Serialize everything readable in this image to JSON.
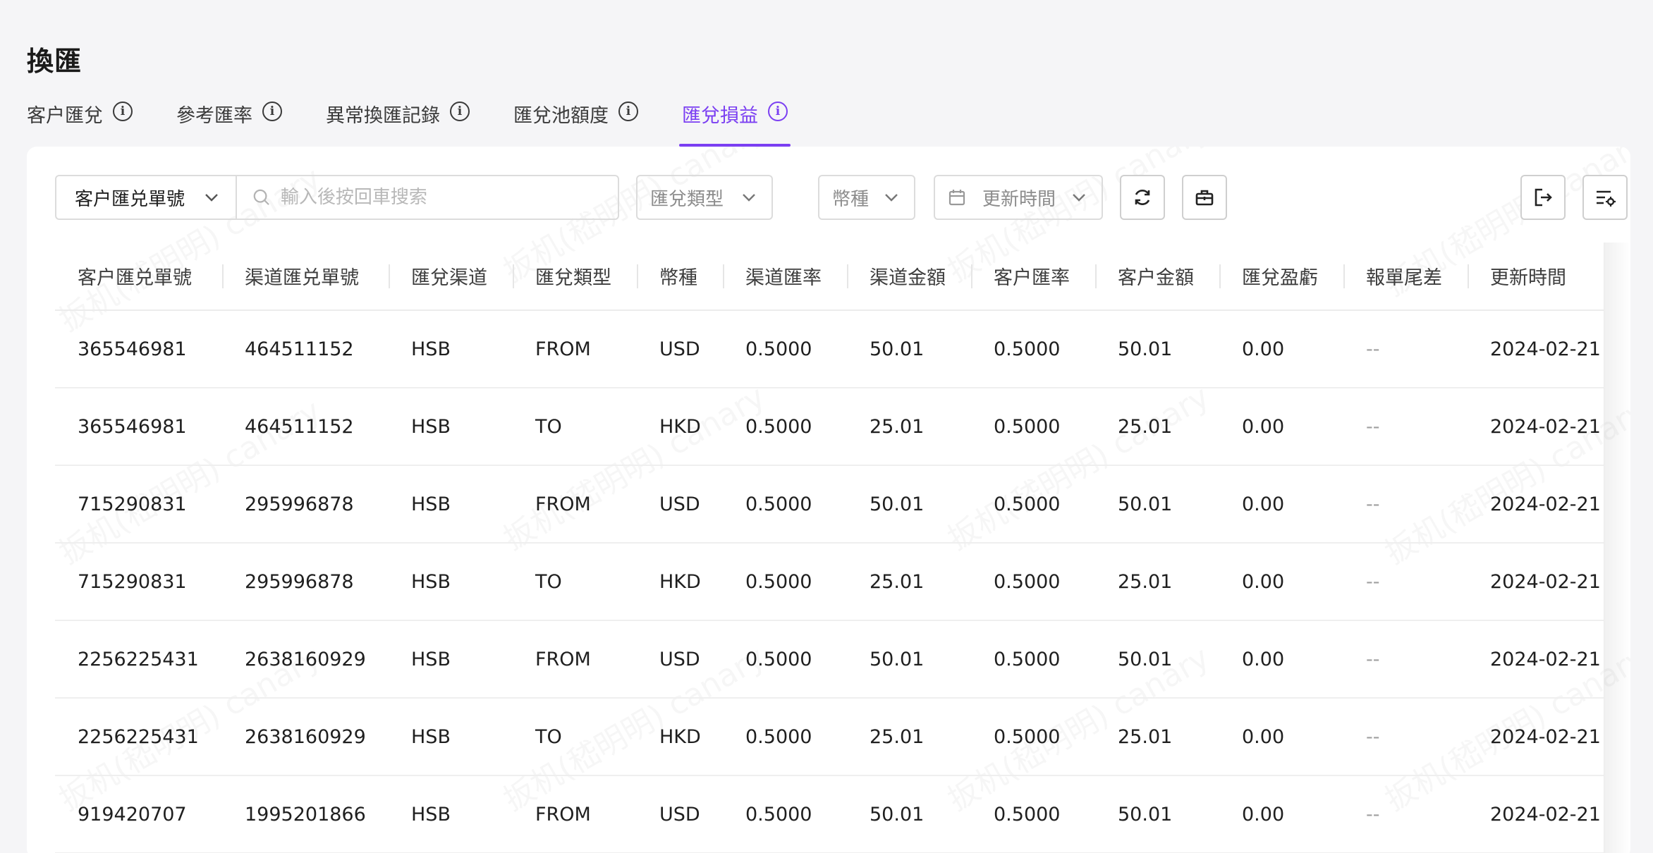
{
  "page": {
    "title": "換匯"
  },
  "tabs": [
    {
      "label": "客户匯兌",
      "active": false
    },
    {
      "label": "參考匯率",
      "active": false
    },
    {
      "label": "異常換匯記錄",
      "active": false
    },
    {
      "label": "匯兌池額度",
      "active": false
    },
    {
      "label": "匯兌損益",
      "active": true
    }
  ],
  "colors": {
    "accent": "#7b3ff2"
  },
  "toolbar": {
    "search_field": "客户匯兑單號",
    "search_placeholder": "輸入後按回車搜索",
    "filter_type": "匯兌類型",
    "filter_currency": "幣種",
    "filter_time": "更新時間",
    "icons": [
      "refresh-icon",
      "toolbox-icon",
      "export-icon",
      "column-settings-icon"
    ]
  },
  "watermark": "扳机(嵇明明) canary",
  "table": {
    "columns": [
      "客户匯兑單號",
      "渠道匯兑單號",
      "匯兌渠道",
      "匯兌類型",
      "幣種",
      "渠道匯率",
      "渠道金額",
      "客户匯率",
      "客户金額",
      "匯兌盈虧",
      "報單尾差",
      "更新時間"
    ],
    "rows": [
      [
        "365546981",
        "464511152",
        "HSB",
        "FROM",
        "USD",
        "0.5000",
        "50.01",
        "0.5000",
        "50.01",
        "0.00",
        "--",
        "2024-02-21"
      ],
      [
        "365546981",
        "464511152",
        "HSB",
        "TO",
        "HKD",
        "0.5000",
        "25.01",
        "0.5000",
        "25.01",
        "0.00",
        "--",
        "2024-02-21"
      ],
      [
        "715290831",
        "295996878",
        "HSB",
        "FROM",
        "USD",
        "0.5000",
        "50.01",
        "0.5000",
        "50.01",
        "0.00",
        "--",
        "2024-02-21"
      ],
      [
        "715290831",
        "295996878",
        "HSB",
        "TO",
        "HKD",
        "0.5000",
        "25.01",
        "0.5000",
        "25.01",
        "0.00",
        "--",
        "2024-02-21"
      ],
      [
        "2256225431",
        "2638160929",
        "HSB",
        "FROM",
        "USD",
        "0.5000",
        "50.01",
        "0.5000",
        "50.01",
        "0.00",
        "--",
        "2024-02-21"
      ],
      [
        "2256225431",
        "2638160929",
        "HSB",
        "TO",
        "HKD",
        "0.5000",
        "25.01",
        "0.5000",
        "25.01",
        "0.00",
        "--",
        "2024-02-21"
      ],
      [
        "919420707",
        "1995201866",
        "HSB",
        "FROM",
        "USD",
        "0.5000",
        "50.01",
        "0.5000",
        "50.01",
        "0.00",
        "--",
        "2024-02-21"
      ]
    ]
  }
}
